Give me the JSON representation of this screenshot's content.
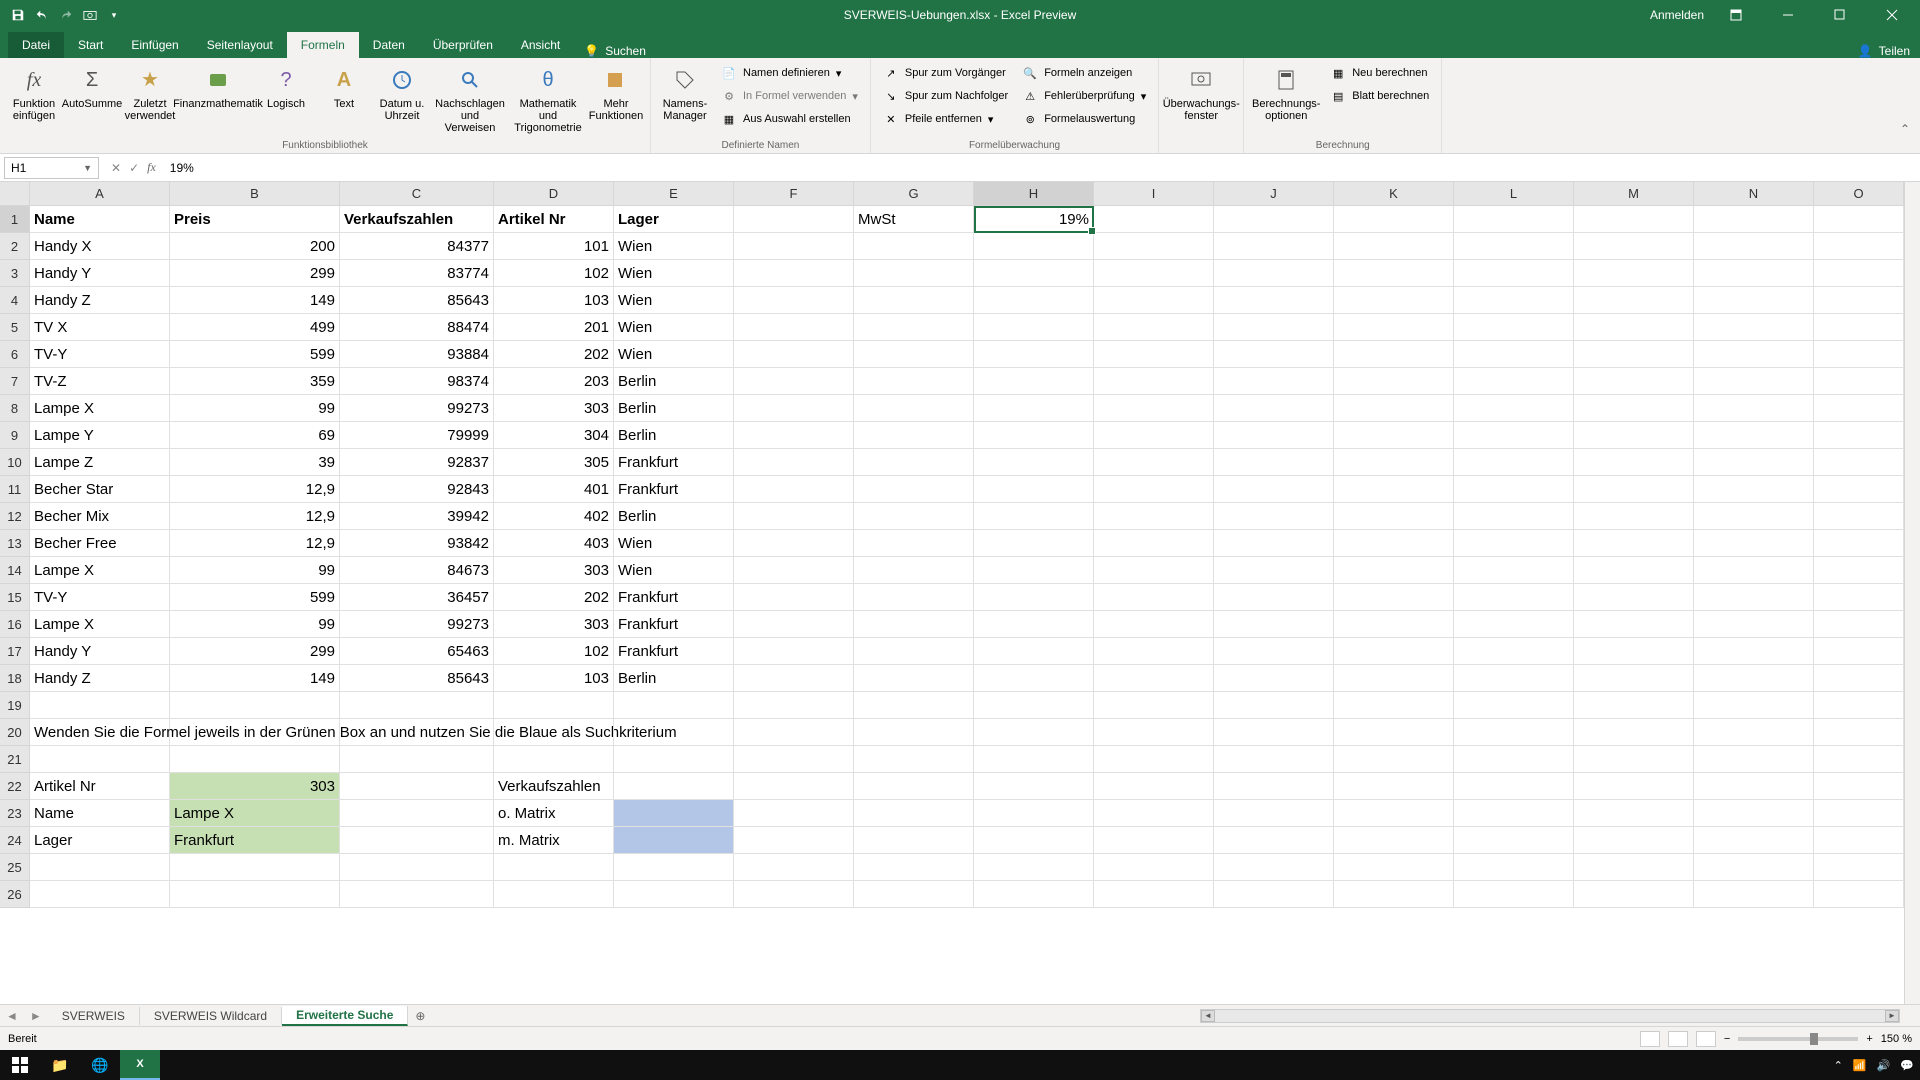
{
  "titlebar": {
    "title": "SVERWEIS-Uebungen.xlsx - Excel Preview",
    "signin": "Anmelden"
  },
  "tabs": {
    "file": "Datei",
    "start": "Start",
    "einfuegen": "Einfügen",
    "seitenlayout": "Seitenlayout",
    "formeln": "Formeln",
    "daten": "Daten",
    "ueberpruefen": "Überprüfen",
    "ansicht": "Ansicht",
    "suchen": "Suchen",
    "teilen": "Teilen"
  },
  "ribbon": {
    "fx_insert": "Funktion einfügen",
    "autosum": "AutoSumme",
    "recent": "Zuletzt verwendet",
    "finance": "Finanzmathematik",
    "logic": "Logisch",
    "text": "Text",
    "datetime": "Datum u. Uhrzeit",
    "lookup": "Nachschlagen und Verweisen",
    "math": "Mathematik und Trigonometrie",
    "more": "Mehr Funktionen",
    "lib_label": "Funktionsbibliothek",
    "name_mgr": "Namens-Manager",
    "define_name": "Namen definieren",
    "use_in_formula": "In Formel verwenden",
    "create_from_sel": "Aus Auswahl erstellen",
    "names_label": "Definierte Namen",
    "trace_prec": "Spur zum Vorgänger",
    "trace_dep": "Spur zum Nachfolger",
    "remove_arrows": "Pfeile entfernen",
    "show_formulas": "Formeln anzeigen",
    "error_check": "Fehlerüberprüfung",
    "evaluate": "Formelauswertung",
    "audit_label": "Formelüberwachung",
    "watch": "Überwachungs-fenster",
    "calc_opts": "Berechnungs-optionen",
    "calc_now": "Neu berechnen",
    "calc_sheet": "Blatt berechnen",
    "calc_label": "Berechnung"
  },
  "namebox": "H1",
  "formula": "19%",
  "columns": [
    "A",
    "B",
    "C",
    "D",
    "E",
    "F",
    "G",
    "H",
    "I",
    "J",
    "K",
    "L",
    "M",
    "N",
    "O"
  ],
  "headers": {
    "A": "Name",
    "B": "Preis",
    "C": "Verkaufszahlen",
    "D": "Artikel Nr",
    "E": "Lager",
    "G": "MwSt",
    "H": "19%"
  },
  "rows": [
    {
      "A": "Handy X",
      "B": "200",
      "C": "84377",
      "D": "101",
      "E": "Wien"
    },
    {
      "A": "Handy Y",
      "B": "299",
      "C": "83774",
      "D": "102",
      "E": "Wien"
    },
    {
      "A": "Handy Z",
      "B": "149",
      "C": "85643",
      "D": "103",
      "E": "Wien"
    },
    {
      "A": "TV X",
      "B": "499",
      "C": "88474",
      "D": "201",
      "E": "Wien"
    },
    {
      "A": "TV-Y",
      "B": "599",
      "C": "93884",
      "D": "202",
      "E": "Wien"
    },
    {
      "A": "TV-Z",
      "B": "359",
      "C": "98374",
      "D": "203",
      "E": "Berlin"
    },
    {
      "A": "Lampe X",
      "B": "99",
      "C": "99273",
      "D": "303",
      "E": "Berlin"
    },
    {
      "A": "Lampe Y",
      "B": "69",
      "C": "79999",
      "D": "304",
      "E": "Berlin"
    },
    {
      "A": "Lampe Z",
      "B": "39",
      "C": "92837",
      "D": "305",
      "E": "Frankfurt"
    },
    {
      "A": "Becher Star",
      "B": "12,9",
      "C": "92843",
      "D": "401",
      "E": "Frankfurt"
    },
    {
      "A": "Becher Mix",
      "B": "12,9",
      "C": "39942",
      "D": "402",
      "E": "Berlin"
    },
    {
      "A": "Becher Free",
      "B": "12,9",
      "C": "93842",
      "D": "403",
      "E": "Wien"
    },
    {
      "A": "Lampe X",
      "B": "99",
      "C": "84673",
      "D": "303",
      "E": "Wien"
    },
    {
      "A": "TV-Y",
      "B": "599",
      "C": "36457",
      "D": "202",
      "E": "Frankfurt"
    },
    {
      "A": "Lampe X",
      "B": "99",
      "C": "99273",
      "D": "303",
      "E": "Frankfurt"
    },
    {
      "A": "Handy Y",
      "B": "299",
      "C": "65463",
      "D": "102",
      "E": "Frankfurt"
    },
    {
      "A": "Handy Z",
      "B": "149",
      "C": "85643",
      "D": "103",
      "E": "Berlin"
    }
  ],
  "instruction": "Wenden Sie die Formel jeweils in der Grünen Box an und nutzen Sie die Blaue als Suchkriterium",
  "lookup": {
    "r22a": "Artikel Nr",
    "r22b": "303",
    "r22d": "Verkaufszahlen",
    "r23a": "Name",
    "r23b": "Lampe X",
    "r23d": "o. Matrix",
    "r24a": "Lager",
    "r24b": "Frankfurt",
    "r24d": "m. Matrix"
  },
  "sheets": {
    "s1": "SVERWEIS",
    "s2": "SVERWEIS Wildcard",
    "s3": "Erweiterte Suche"
  },
  "status": {
    "ready": "Bereit",
    "zoom": "150 %"
  },
  "selected_cell": "H1"
}
